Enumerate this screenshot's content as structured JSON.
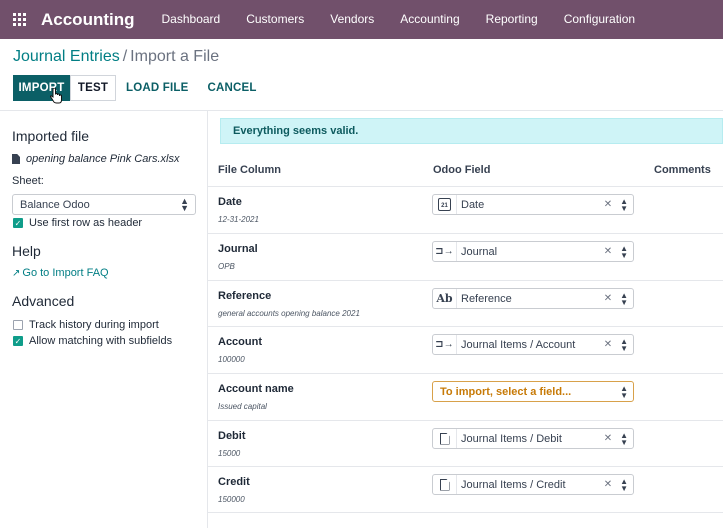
{
  "navbar": {
    "app_name": "Accounting",
    "menu": [
      "Dashboard",
      "Customers",
      "Vendors",
      "Accounting",
      "Reporting",
      "Configuration"
    ],
    "background": "#71506b"
  },
  "breadcrumb": {
    "parent": "Journal Entries",
    "separator": "/",
    "current": "Import a File"
  },
  "buttons": {
    "import": "IMPORT",
    "test": "TEST",
    "load_file": "LOAD FILE",
    "cancel": "CANCEL"
  },
  "sidebar": {
    "imported_file_heading": "Imported file",
    "file_name": "opening balance Pink Cars.xlsx",
    "sheet_label": "Sheet:",
    "sheet_value": "Balance Odoo",
    "first_row_header_label": "Use first row as header",
    "first_row_header_checked": true,
    "help_heading": "Help",
    "faq_link": "Go to Import FAQ",
    "advanced_heading": "Advanced",
    "track_history_label": "Track history during import",
    "track_history_checked": false,
    "subfields_label": "Allow matching with subfields",
    "subfields_checked": true
  },
  "alert": {
    "message": "Everything seems valid."
  },
  "table": {
    "headers": {
      "file_column": "File Column",
      "odoo_field": "Odoo Field",
      "comments": "Comments"
    },
    "rows": [
      {
        "label": "Date",
        "sample": "12-31-2021",
        "icon": "calendar-icon",
        "field": "Date",
        "clearable": true
      },
      {
        "label": "Journal",
        "sample": "OPB",
        "icon": "relation-icon",
        "field": "Journal",
        "clearable": true
      },
      {
        "label": "Reference",
        "sample": "general accounts opening balance 2021",
        "icon": "text-icon",
        "field": "Reference",
        "clearable": true
      },
      {
        "label": "Account",
        "sample": "100000",
        "icon": "relation-icon",
        "field": "Journal Items / Account",
        "clearable": true
      },
      {
        "label": "Account name",
        "sample": "Issued capital",
        "icon": "",
        "field": "To import, select a field...",
        "clearable": false
      },
      {
        "label": "Debit",
        "sample": "15000",
        "icon": "document-icon",
        "field": "Journal Items / Debit",
        "clearable": true
      },
      {
        "label": "Credit",
        "sample": "150000",
        "icon": "document-icon",
        "field": "Journal Items / Credit",
        "clearable": true
      }
    ]
  }
}
